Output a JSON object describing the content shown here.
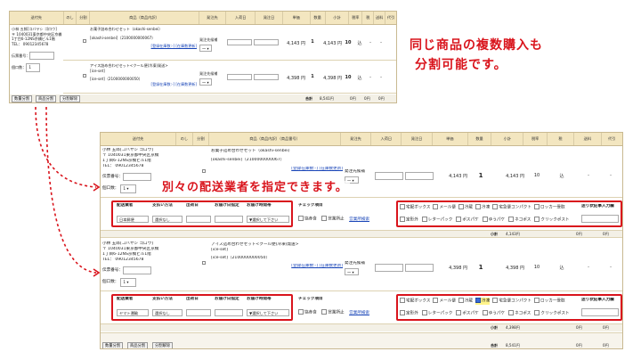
{
  "header": {
    "cols": [
      "送付先",
      "のし",
      "分割",
      "商品（商品内訳）",
      "発注先",
      "入荷日",
      "発注日",
      "単価",
      "数量",
      "小計",
      "税率",
      "税",
      "送料",
      "代引"
    ],
    "cols_b": [
      "送付先",
      "のし",
      "分割",
      "商品（商品内訳）（商品番号）",
      "発注先",
      "入荷日",
      "発注日",
      "単価",
      "数量",
      "小計",
      "税率",
      "税",
      "送料",
      "代引"
    ]
  },
  "customer": {
    "name": "小林 五郎[コバヤシ ゴロウ]",
    "zip": "〒 1040031東京都中央区京橋",
    "addr": "1丁目6-12NS京橋ビル1階",
    "tel": "TEL： 09012345678",
    "slip_label": "伝票番号：",
    "count_label": "個口数：",
    "count_value": "1"
  },
  "items": [
    {
      "name": "お菓子詰め合わせセット（okashi-senbei）",
      "code": "[okashi-senbei]（2100000000067）",
      "links": "[登録在庫数:-] [在庫数更新]",
      "supplier": "発注先候補",
      "price": "4,143 円",
      "qty": "1",
      "subtotal": "4,143 円",
      "tax_rate": "10",
      "tax": "込",
      "shipping": "-",
      "cod": "-",
      "carrier": "日本郵便",
      "payment": "選択なし",
      "time_select": "▼選択して下さい"
    },
    {
      "name": "アイス詰め合わせセット<クール便(冷凍)発送>",
      "code": "[ice-set]（2100000000050）",
      "links": "[登録在庫数:-] [在庫数更新]",
      "supplier": "発注先候補",
      "price": "4,398 円",
      "qty": "1",
      "subtotal": "4,398 円",
      "tax_rate": "10",
      "tax": "込",
      "shipping": "-",
      "cod": "-",
      "carrier": "ヤマト運輸",
      "payment": "選択なし",
      "time_select": "▼選択して下さい"
    }
  ],
  "top_items": [
    {
      "name": "お菓子詰め合わせセット（okashi-senbei）",
      "code": "[okashi-senbei]（2100000000067）",
      "price": "4,143 円",
      "subtotal": "4,143 円"
    },
    {
      "name": "アイス詰め合わせセット<クール便(冷凍)発送>",
      "code": "[ice-set]",
      "code2": "[ice-set]（2100000000050）",
      "price": "4,398 円",
      "subtotal": "4,398 円"
    }
  ],
  "top_links": "[登録在庫数:-] [在庫数更新]",
  "top_links_b": "[登録在庫数:-] [在庫数更新]",
  "shipping_headers": [
    "配送業者",
    "支払い方法",
    "出荷日",
    "お届け日指定",
    "お届け時間帯"
  ],
  "check_label": "チェック項目",
  "check_items": [
    "協赤食",
    "営業所止",
    "営業所検索"
  ],
  "delivery_opts_row1": [
    "宅配ボックス",
    "メール便",
    "冷蔵",
    "冷凍",
    "宅急便コンパクト",
    "ロッカー受取"
  ],
  "delivery_opts_row2": [
    "定形外",
    "レターパック",
    "ポスパケ",
    "ゆうパケ",
    "ネコポス",
    "クリックポスト"
  ],
  "slip_entry_label": "送り状記事入力欄",
  "subtotal_label": "小計",
  "subtotal_values": [
    "4,143円",
    "4,398円"
  ],
  "total_label": "合計",
  "total_value": "8,541円",
  "zero": "0円",
  "buttons": [
    "数量分割",
    "商品分割",
    "分割解除"
  ],
  "callout_top_line1": "同じ商品の複数購入も",
  "callout_top_line2": "分割可能です。",
  "callout_mid": "別々の配送業者を指定できます。",
  "item_selector": "～ ▾",
  "count_select": "1 ▾"
}
